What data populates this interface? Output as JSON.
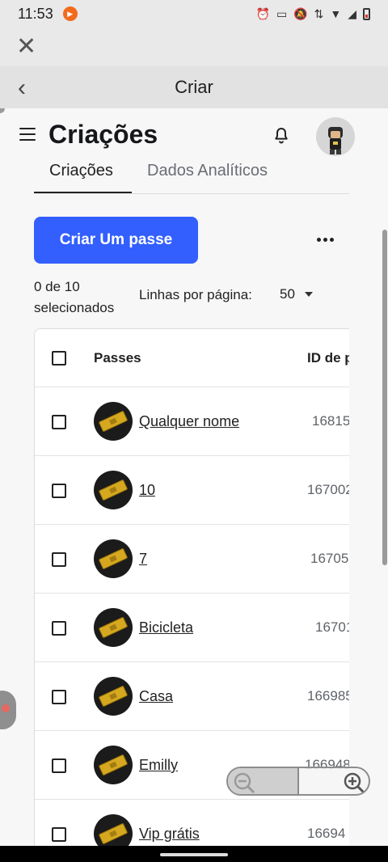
{
  "status_bar": {
    "time": "11:53"
  },
  "title_bar": {
    "title": "Criar"
  },
  "header": {
    "title": "Criações"
  },
  "tabs": [
    {
      "label": "Criações",
      "active": true
    },
    {
      "label": "Dados Analíticos",
      "active": false
    }
  ],
  "actions": {
    "create_button": "Criar Um passe"
  },
  "pagination": {
    "selected": "0 de 10 selecionados",
    "rows_label": "Linhas por página:",
    "rows_value": "50"
  },
  "table": {
    "columns": [
      "Passes",
      "ID de p"
    ],
    "rows": [
      {
        "name": "Qualquer nome",
        "id": "16815"
      },
      {
        "name": "10",
        "id": "167002"
      },
      {
        "name": "7",
        "id": "16705"
      },
      {
        "name": "Bicicleta",
        "id": "16701"
      },
      {
        "name": "Casa",
        "id": "166985"
      },
      {
        "name": "Emilly",
        "id": "166948"
      },
      {
        "name": "Vip grátis",
        "id": "16694"
      }
    ]
  },
  "colors": {
    "primary_button": "#335fff",
    "ticket_gold": "#d6a820"
  }
}
